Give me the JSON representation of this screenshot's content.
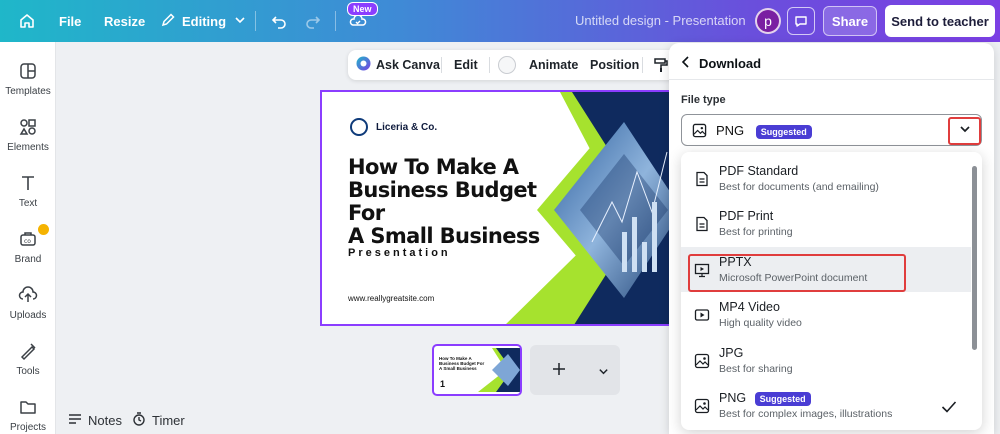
{
  "topbar": {
    "file": "File",
    "resize": "Resize",
    "editing": "Editing",
    "new_badge": "New",
    "doc_title": "Untitled design - Presentation",
    "avatar_initial": "p",
    "share": "Share",
    "send_to_teacher": "Send to teacher"
  },
  "sidebar": {
    "items": [
      {
        "label": "Templates",
        "icon": "templates-icon"
      },
      {
        "label": "Elements",
        "icon": "elements-icon"
      },
      {
        "label": "Text",
        "icon": "text-icon"
      },
      {
        "label": "Brand",
        "icon": "brand-icon"
      },
      {
        "label": "Uploads",
        "icon": "uploads-icon"
      },
      {
        "label": "Tools",
        "icon": "tools-icon"
      },
      {
        "label": "Projects",
        "icon": "projects-icon"
      }
    ]
  },
  "context_toolbar": {
    "ask_canva": "Ask Canva",
    "edit": "Edit",
    "animate": "Animate",
    "position": "Position"
  },
  "slide": {
    "brand": "Liceria & Co.",
    "title_line1": "How To Make A",
    "title_line2": "Business Budget For",
    "title_line3": "A Small Business",
    "subtitle": "Presentation",
    "website": "www.reallygreatsite.com"
  },
  "thumbnail": {
    "page_number": "1",
    "title": "How To Make A Business Budget For A Small Business"
  },
  "bottom": {
    "notes": "Notes",
    "timer": "Timer"
  },
  "download": {
    "header": "Download",
    "file_type_label": "File type",
    "selected_value": "PNG",
    "selected_badge": "Suggested",
    "options": [
      {
        "title": "PDF Standard",
        "subtitle": "Best for documents (and emailing)",
        "icon": "document-icon"
      },
      {
        "title": "PDF Print",
        "subtitle": "Best for printing",
        "icon": "document-icon"
      },
      {
        "title": "PPTX",
        "subtitle": "Microsoft PowerPoint document",
        "icon": "presentation-icon"
      },
      {
        "title": "MP4 Video",
        "subtitle": "High quality video",
        "icon": "video-icon"
      },
      {
        "title": "JPG",
        "subtitle": "Best for sharing",
        "icon": "image-icon"
      },
      {
        "title": "PNG",
        "subtitle": "Best for complex images, illustrations",
        "icon": "image-icon",
        "badge": "Suggested",
        "checked": true
      }
    ]
  },
  "colors": {
    "accent": "#8b3dff",
    "highlight_red": "#e03d3d",
    "slide_green": "#a6e22e",
    "slide_navy": "#0f2a5e"
  }
}
